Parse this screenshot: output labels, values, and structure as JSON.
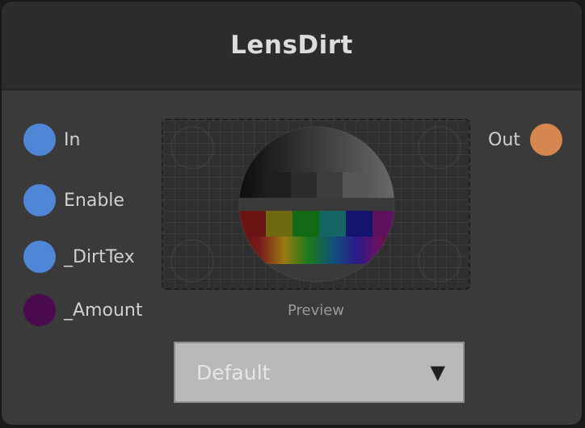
{
  "node": {
    "title": "LensDirt",
    "inputs": [
      {
        "label": "In",
        "color": "#4f86d6"
      },
      {
        "label": "Enable",
        "color": "#4f86d6"
      },
      {
        "label": "_DirtTex",
        "color": "#4f86d6"
      },
      {
        "label": "_Amount",
        "color": "#4a0a4e"
      }
    ],
    "outputs": [
      {
        "label": "Out",
        "color": "#d6864f"
      }
    ],
    "preview": {
      "caption": "Preview"
    },
    "dropdown": {
      "value": "Default",
      "arrow": "▼"
    }
  }
}
